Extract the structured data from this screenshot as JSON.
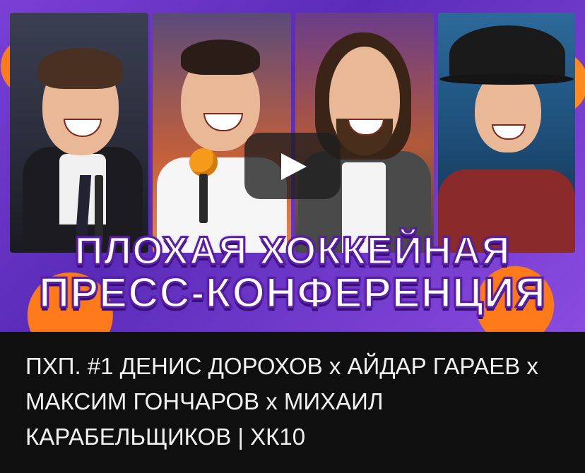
{
  "video": {
    "thumbnail_title_line1": "ПЛОХАЯ ХОККЕЙНАЯ",
    "thumbnail_title_line2": "ПРЕСС-КОНФЕРЕНЦИЯ",
    "play_icon": "play-icon",
    "title": "ПХП. #1 ДЕНИС ДОРОХОВ х АЙДАР ГАРАЕВ х МАКСИМ ГОНЧАРОВ х МИХАИЛ КАРАБЕЛЬЩИКОВ | ХК10"
  },
  "colors": {
    "background": "#0f0f0f",
    "accent_purple": "#7b3fd6",
    "accent_orange": "#ff7a1a",
    "title_text": "#f1f1f1"
  }
}
